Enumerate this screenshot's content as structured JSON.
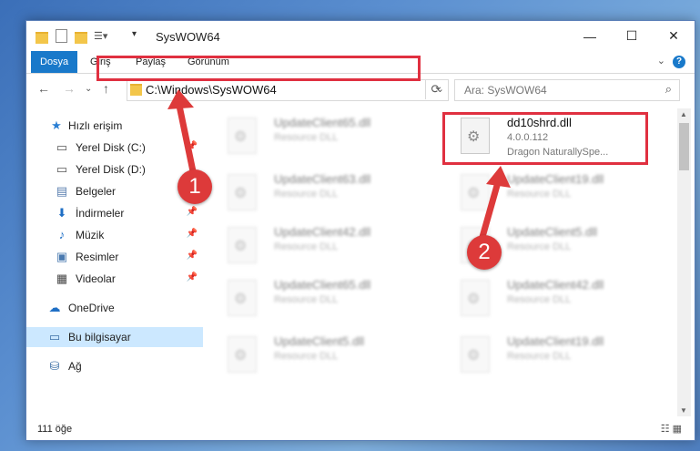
{
  "window": {
    "title": "SysWOW64"
  },
  "ribbon": {
    "tabs": [
      "Dosya",
      "Giriş",
      "Paylaş",
      "Görünüm"
    ],
    "help": "?"
  },
  "nav": {
    "address": "C:\\Windows\\SysWOW64",
    "search_placeholder": "Ara: SysWOW64"
  },
  "sidebar": {
    "items": [
      {
        "label": "Hızlı erişim",
        "icon": "star-icon"
      },
      {
        "label": "Yerel Disk (C:)",
        "icon": "drive-icon",
        "pinned": true
      },
      {
        "label": "Yerel Disk (D:)",
        "icon": "drive-icon"
      },
      {
        "label": "Belgeler",
        "icon": "document-icon"
      },
      {
        "label": "İndirmeler",
        "icon": "download-icon",
        "pinned": true
      },
      {
        "label": "Müzik",
        "icon": "music-icon",
        "pinned": true
      },
      {
        "label": "Resimler",
        "icon": "pictures-icon",
        "pinned": true
      },
      {
        "label": "Videolar",
        "icon": "video-icon",
        "pinned": true
      },
      {
        "label": "OneDrive",
        "icon": "cloud-icon"
      },
      {
        "label": "Bu bilgisayar",
        "icon": "computer-icon",
        "selected": true
      },
      {
        "label": "Ağ",
        "icon": "network-icon"
      }
    ]
  },
  "files": [
    {
      "name": "UpdateClient65.dll",
      "line1": "Resource DLL",
      "line2": ""
    },
    {
      "name": "dd10shrd.dll",
      "line1": "4.0.0.112",
      "line2": "Dragon NaturallySpe..."
    },
    {
      "name": "UpdateClient63.dll",
      "line1": "Resource DLL",
      "line2": ""
    },
    {
      "name": "UpdateClient19.dll",
      "line1": "Resource DLL",
      "line2": ""
    },
    {
      "name": "UpdateClient42.dll",
      "line1": "Resource DLL",
      "line2": ""
    },
    {
      "name": "UpdateClient5.dll",
      "line1": "Resource DLL",
      "line2": ""
    },
    {
      "name": "UpdateClient65.dll",
      "line1": "Resource DLL",
      "line2": ""
    },
    {
      "name": "UpdateClient42.dll",
      "line1": "Resource DLL",
      "line2": ""
    },
    {
      "name": "UpdateClient5.dll",
      "line1": "Resource DLL",
      "line2": ""
    },
    {
      "name": "UpdateClient19.dll",
      "line1": "Resource DLL",
      "line2": ""
    }
  ],
  "status": {
    "count": "111 öğe"
  },
  "annotations": {
    "step1": "1",
    "step2": "2",
    "color": "#dd3a3a"
  }
}
